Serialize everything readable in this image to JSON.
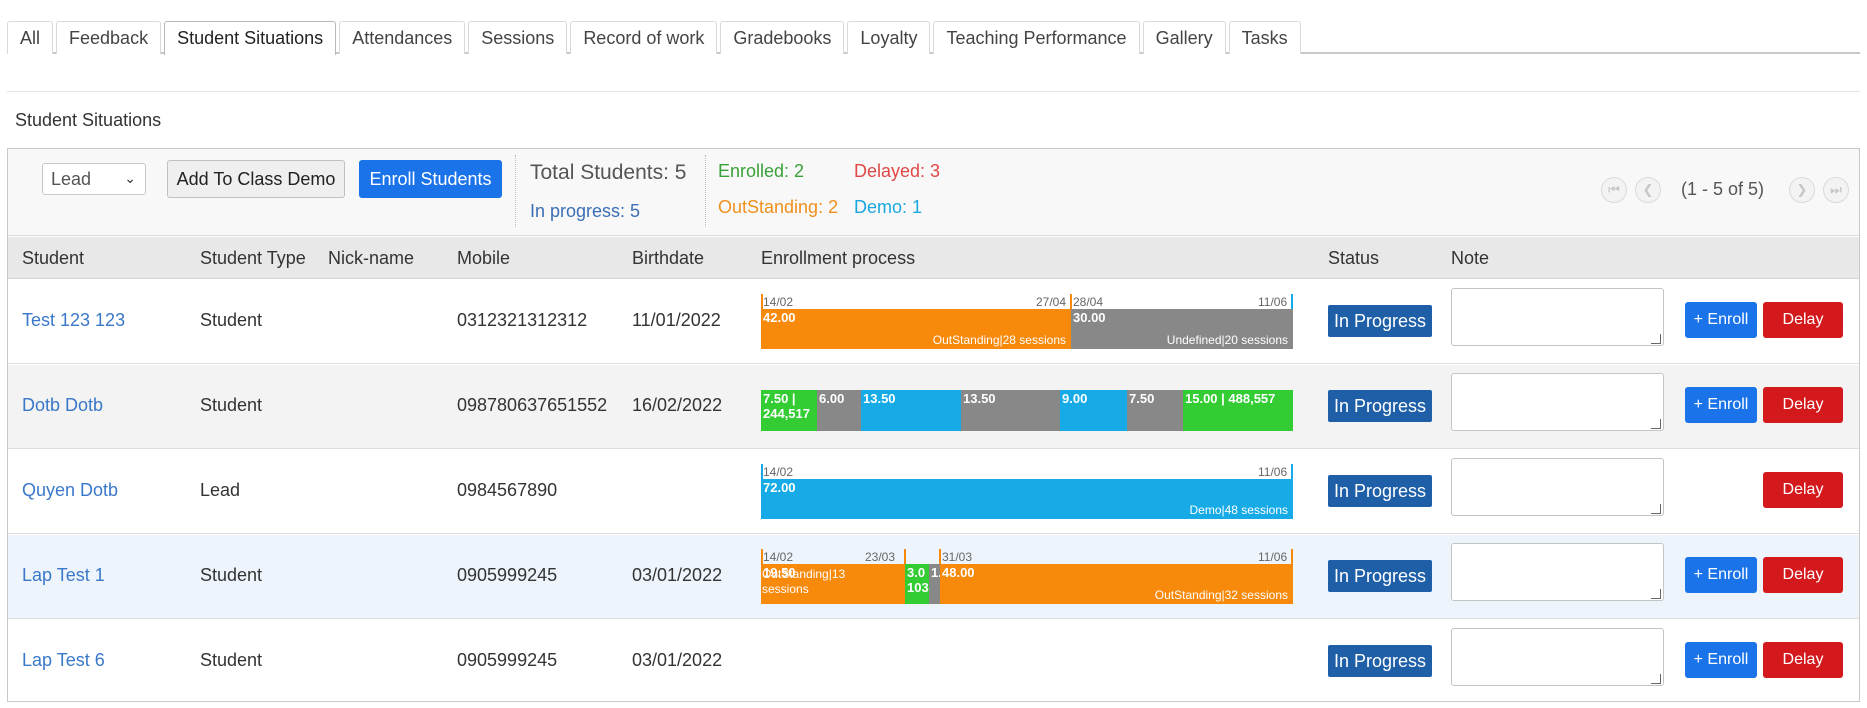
{
  "tabs": [
    "All",
    "Feedback",
    "Student Situations",
    "Attendances",
    "Sessions",
    "Record of work",
    "Gradebooks",
    "Loyalty",
    "Teaching Performance",
    "Gallery",
    "Tasks"
  ],
  "section_title": "Student Situations",
  "toolbar": {
    "select_value": "Lead",
    "add_demo_label": "Add To Class Demo",
    "enroll_label": "Enroll Students",
    "total": "Total Students: 5",
    "in_progress": "In progress: 5",
    "enrolled": "Enrolled: 2",
    "delayed": "Delayed: 3",
    "outstanding": "OutStanding: 2",
    "demo": "Demo: 1"
  },
  "pager": {
    "text": "(1 - 5 of 5)"
  },
  "columns": [
    "Student",
    "Student Type",
    "Nick-name",
    "Mobile",
    "Birthdate",
    "Enrollment process",
    "Status",
    "Note"
  ],
  "rows": [
    {
      "name": "Test 123 123",
      "type": "Student",
      "nick": "",
      "mobile": "0312321312312",
      "birthdate": "11/01/2022",
      "status": "In Progress",
      "enroll": "+ Enroll",
      "delay": "Delay",
      "dates": [
        "14/02",
        "27/04",
        "28/04",
        "11/06"
      ],
      "segs": [
        {
          "value": "42.00",
          "label": "OutStanding|28 sessions"
        },
        {
          "value": "30.00",
          "label": "Undefined|20 sessions"
        }
      ]
    },
    {
      "name": "Dotb Dotb",
      "type": "Student",
      "nick": "",
      "mobile": "098780637651552",
      "birthdate": "16/02/2022",
      "status": "In Progress",
      "enroll": "+ Enroll",
      "delay": "Delay",
      "segs": [
        {
          "value": "7.50 | 244,517"
        },
        {
          "value": "6.00"
        },
        {
          "value": "13.50"
        },
        {
          "value": "13.50"
        },
        {
          "value": "9.00"
        },
        {
          "value": "7.50"
        },
        {
          "value": "15.00 | 488,557"
        }
      ]
    },
    {
      "name": "Quyen Dotb",
      "type": "Lead",
      "nick": "",
      "mobile": "0984567890",
      "birthdate": "",
      "status": "In Progress",
      "enroll": "",
      "delay": "Delay",
      "dates": [
        "14/02",
        "11/06"
      ],
      "segs": [
        {
          "value": "72.00",
          "label": "Demo|48 sessions"
        }
      ]
    },
    {
      "name": "Lap Test 1",
      "type": "Student",
      "nick": "",
      "mobile": "0905999245",
      "birthdate": "03/01/2022",
      "status": "In Progress",
      "enroll": "+ Enroll",
      "delay": "Delay",
      "dates": [
        "14/02",
        "23/03",
        "31/03",
        "11/06"
      ],
      "segs": [
        {
          "value": "19.50",
          "label": "OutStanding|13 sessions"
        },
        {
          "value": "3.0 103"
        },
        {
          "value": "1."
        },
        {
          "value": "48.00",
          "label": "OutStanding|32 sessions"
        }
      ]
    },
    {
      "name": "Lap Test 6",
      "type": "Student",
      "nick": "",
      "mobile": "0905999245",
      "birthdate": "03/01/2022",
      "status": "In Progress",
      "enroll": "+ Enroll",
      "delay": "Delay"
    }
  ]
}
